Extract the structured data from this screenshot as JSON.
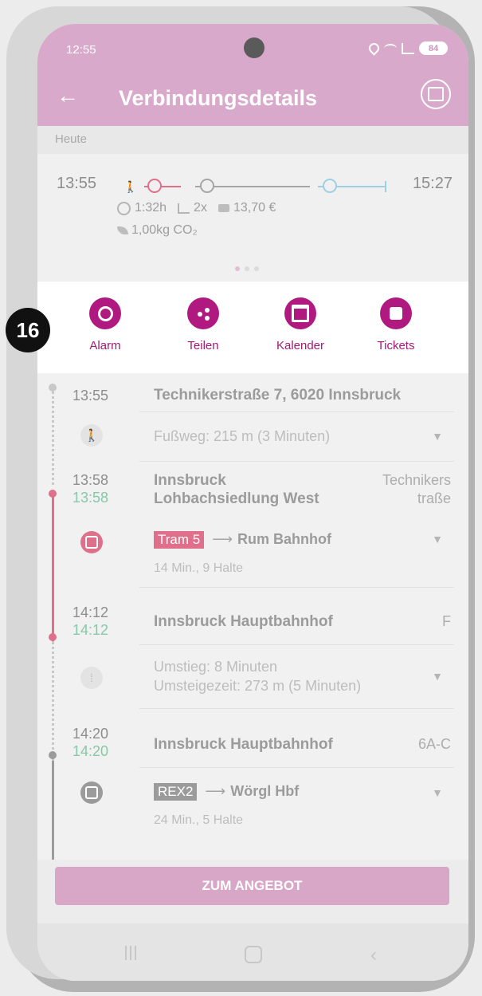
{
  "status": {
    "time": "12:55",
    "battery": "84"
  },
  "header": {
    "title": "Verbindungsdetails",
    "back": "←"
  },
  "today": {
    "label": "Heute"
  },
  "summary": {
    "departure": "13:55",
    "arrival": "15:27",
    "duration": "1:32h",
    "changes": "2x",
    "price": "13,70 €",
    "co2": "1,00kg CO₂"
  },
  "actions": {
    "alarm": "Alarm",
    "share": "Teilen",
    "calendar": "Kalender",
    "tickets": "Tickets"
  },
  "step_badge": "16",
  "itinerary": {
    "start": {
      "time": "13:55",
      "place": "Technikerstraße 7, 6020 Innsbruck"
    },
    "walk": {
      "text": "Fußweg: 215 m (3 Minuten)"
    },
    "stop1": {
      "time": "13:58",
      "time_rt": "13:58",
      "place_line1": "Innsbruck",
      "place_line2": "Lohbachsiedlung West",
      "platform_line1": "Technikers",
      "platform_line2": "traße"
    },
    "tram": {
      "badge": "Tram 5",
      "destination": "Rum Bahnhof",
      "info": "14 Min., 9 Halte"
    },
    "stop2": {
      "time": "14:12",
      "time_rt": "14:12",
      "place": "Innsbruck Hauptbahnhof",
      "platform": "F"
    },
    "transfer": {
      "line1": "Umstieg: 8 Minuten",
      "line2": "Umsteigezeit: 273 m (5 Minuten)"
    },
    "stop3": {
      "time": "14:20",
      "time_rt": "14:20",
      "place": "Innsbruck Hauptbahnhof",
      "platform": "6A-C"
    },
    "train": {
      "badge": "REX2",
      "destination": "Wörgl Hbf",
      "info": "24 Min., 5 Halte"
    }
  },
  "offer": {
    "label": "ZUM ANGEBOT"
  },
  "colors": {
    "brand": "#b0197f",
    "header": "#d9a9cb",
    "tram": "#e06f8b",
    "train": "#9b9b9b",
    "realtime": "#85c9a6",
    "route_gray": "#a6a6a6",
    "route_blue": "#9ecfe3"
  }
}
